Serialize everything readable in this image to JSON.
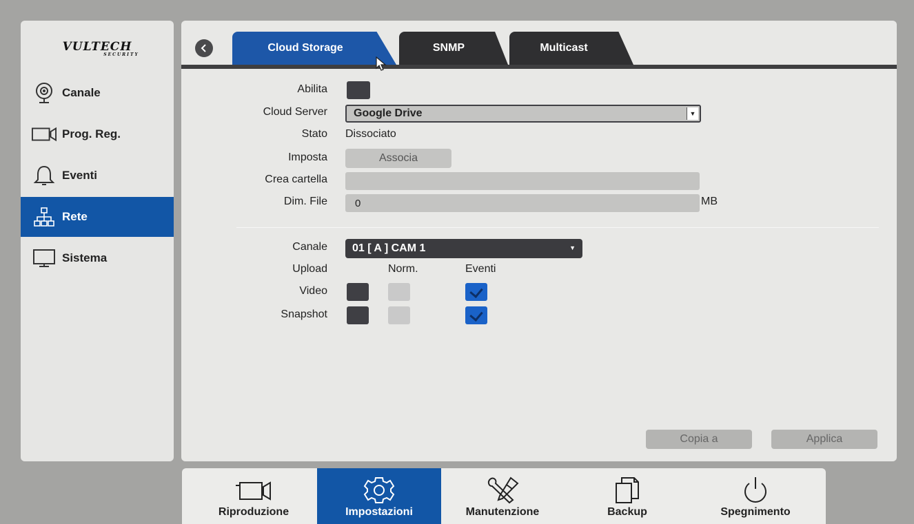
{
  "brand": {
    "logo_text": "VULTECH",
    "logo_sub": "SECURITY"
  },
  "sidebar": {
    "items": [
      {
        "label": "Canale",
        "icon": "webcam-icon"
      },
      {
        "label": "Prog. Reg.",
        "icon": "camera-icon"
      },
      {
        "label": "Eventi",
        "icon": "bell-icon"
      },
      {
        "label": "Rete",
        "icon": "network-icon",
        "active": true
      },
      {
        "label": "Sistema",
        "icon": "monitor-icon"
      }
    ]
  },
  "tabs": [
    {
      "label": "Cloud Storage",
      "active": true
    },
    {
      "label": "SNMP"
    },
    {
      "label": "Multicast"
    }
  ],
  "form": {
    "enable_label": "Abilita",
    "cloud_server_label": "Cloud Server",
    "cloud_server_value": "Google Drive",
    "status_label": "Stato",
    "status_value": "Dissociato",
    "set_label": "Imposta",
    "associate_button": "Associa",
    "create_folder_label": "Crea cartella",
    "create_folder_value": "",
    "file_size_label": "Dim. File",
    "file_size_value": "0",
    "file_size_unit": "MB",
    "channel_label": "Canale",
    "channel_value": "01 [ A ] CAM 1",
    "upload_label": "Upload",
    "norm_header": "Norm.",
    "events_header": "Eventi",
    "video_label": "Video",
    "snapshot_label": "Snapshot",
    "copy_button": "Copia a",
    "apply_button": "Applica"
  },
  "bottom_bar": {
    "items": [
      {
        "label": "Riproduzione",
        "icon": "camera-icon"
      },
      {
        "label": "Impostazioni",
        "icon": "gear-icon",
        "active": true
      },
      {
        "label": "Manutenzione",
        "icon": "tools-icon"
      },
      {
        "label": "Backup",
        "icon": "copy-icon"
      },
      {
        "label": "Spegnimento",
        "icon": "power-icon"
      }
    ]
  },
  "colors": {
    "accent": "#1256a6",
    "tab_dark": "#2f2f31",
    "panel": "#e8e8e6",
    "checkbox_blue": "#1a62c8"
  }
}
